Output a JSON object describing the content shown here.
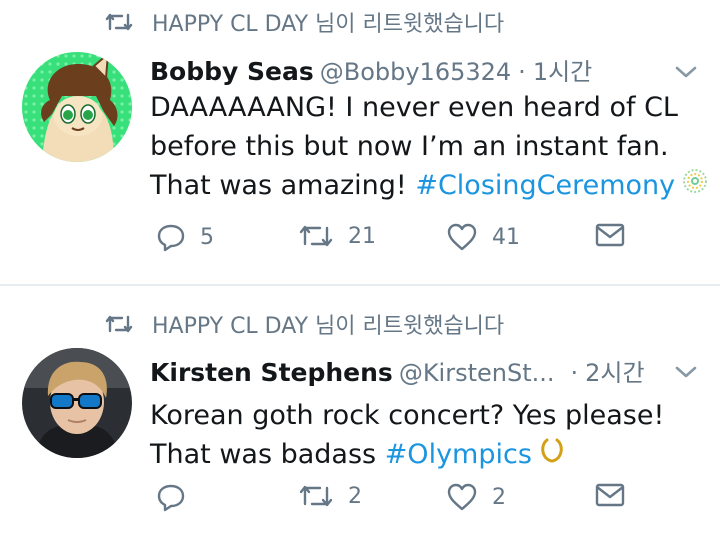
{
  "tweets": [
    {
      "retweeted_by": "HAPPY CL DAY 님이 리트윗했습니다",
      "name": "Bobby Seas",
      "handle": "@Bobby165324",
      "dot": "·",
      "time": "1시간",
      "body_lines": [
        "DAAAAAANG! I never even heard of CL",
        "before this but now I’m an instant fan.",
        "That was amazing! "
      ],
      "hashtag": "#ClosingCeremony",
      "emoji": "olympic-rings-emoji",
      "replies": "5",
      "retweets": "21",
      "likes": "41"
    },
    {
      "retweeted_by": "HAPPY CL DAY 님이 리트윗했습니다",
      "name": "Kirsten Stephens",
      "handle": "@KirstenSt...",
      "dot": "·",
      "time": "2시간",
      "body_lines": [
        "Korean goth rock concert? Yes please!",
        "That was badass "
      ],
      "hashtag": "#Olympics",
      "emoji": "laurel-wreath-emoji",
      "replies": "",
      "retweets": "2",
      "likes": "2"
    }
  ],
  "colors": {
    "text": "#14171a",
    "muted": "#657786",
    "link": "#1b95e0",
    "divider": "#e6ecf0"
  }
}
